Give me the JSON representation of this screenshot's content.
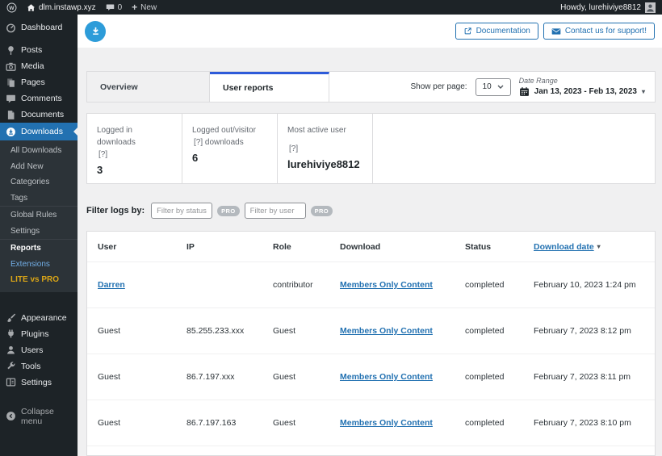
{
  "admin_bar": {
    "site_name": "dlm.instawp.xyz",
    "comments_count": "0",
    "new_label": "New",
    "howdy_text": "Howdy, lurehiviye8812"
  },
  "sidebar": {
    "items": [
      {
        "label": "Dashboard",
        "icon": "dashboard-icon"
      },
      {
        "label": "Posts",
        "icon": "posts-icon"
      },
      {
        "label": "Media",
        "icon": "media-icon"
      },
      {
        "label": "Pages",
        "icon": "pages-icon"
      },
      {
        "label": "Comments",
        "icon": "comments-icon"
      },
      {
        "label": "Documents",
        "icon": "documents-icon"
      },
      {
        "label": "Downloads",
        "icon": "downloads-icon"
      }
    ],
    "downloads_submenu": [
      {
        "label": "All Downloads"
      },
      {
        "label": "Add New"
      },
      {
        "label": "Categories"
      },
      {
        "label": "Tags"
      },
      {
        "label": "Global Rules"
      },
      {
        "label": "Settings"
      },
      {
        "label": "Reports",
        "state": "current"
      },
      {
        "label": "Extensions",
        "state": "highlight-blue"
      },
      {
        "label": "LITE vs PRO",
        "state": "highlight-yellow"
      }
    ],
    "lower_items": [
      {
        "label": "Appearance",
        "icon": "appearance-icon"
      },
      {
        "label": "Plugins",
        "icon": "plugins-icon"
      },
      {
        "label": "Users",
        "icon": "users-icon"
      },
      {
        "label": "Tools",
        "icon": "tools-icon"
      },
      {
        "label": "Settings",
        "icon": "settings-icon"
      }
    ],
    "collapse_label": "Collapse menu"
  },
  "page_header": {
    "documentation_button": "Documentation",
    "contact_button": "Contact us for support!"
  },
  "tabs": {
    "overview_label": "Overview",
    "user_reports_label": "User reports"
  },
  "controls": {
    "show_per_page_label": "Show per page:",
    "per_page_value": "10",
    "date_range_label": "Date Range",
    "date_range_value": "Jan 13, 2023 - Feb 13, 2023"
  },
  "stats_cards": [
    {
      "label_line1": "Logged in downloads",
      "label_line2": "[?]",
      "value": "3"
    },
    {
      "label_line1": "Logged out/visitor",
      "label_line2": "[?] downloads",
      "value": "6"
    },
    {
      "label_line1": "Most active user",
      "label_line2": "[?]",
      "value": "lurehiviye8812"
    }
  ],
  "filters": {
    "label": "Filter logs by:",
    "status_placeholder": "Filter by status",
    "user_placeholder": "Filter by user",
    "pro_badge": "PRO"
  },
  "logs_table": {
    "headers": {
      "user": "User",
      "ip": "IP",
      "role": "Role",
      "download": "Download",
      "status": "Status",
      "download_date": "Download date"
    },
    "sort_caret": "▾",
    "rows": [
      {
        "user": "Darren",
        "ip": "",
        "role": "contributor",
        "download": "Members Only Content",
        "status": "completed",
        "date": "February 10, 2023 1:24 pm"
      },
      {
        "user": "Guest",
        "ip": "85.255.233.xxx",
        "role": "Guest",
        "download": "Members Only Content",
        "status": "completed",
        "date": "February 7, 2023 8:12 pm"
      },
      {
        "user": "Guest",
        "ip": "86.7.197.xxx",
        "role": "Guest",
        "download": "Members Only Content",
        "status": "completed",
        "date": "February 7, 2023 8:11 pm"
      },
      {
        "user": "Guest",
        "ip": "86.7.197.163",
        "role": "Guest",
        "download": "Members Only Content",
        "status": "completed",
        "date": "February 7, 2023 8:10 pm"
      }
    ]
  },
  "icons": {
    "wp-logo-icon": "W in circle",
    "home-icon": "house",
    "comments-bubble-icon": "speech bubble",
    "plus-icon": "+",
    "avatar-icon": "person silhouette",
    "dlm-logo-icon": "download arrow in blue circle",
    "external-link-icon": "box with arrow",
    "mail-icon": "envelope",
    "calendar-icon": "calendar grid",
    "caret-down-icon": "▾"
  },
  "colors": {
    "admin_dark": "#1d2327",
    "accent_blue": "#2271b1",
    "active_tab_border": "#2e5bd9",
    "logo_blue": "#2d9cd9",
    "extensions_link": "#72aee6",
    "lite_vs_pro": "#dba617"
  }
}
